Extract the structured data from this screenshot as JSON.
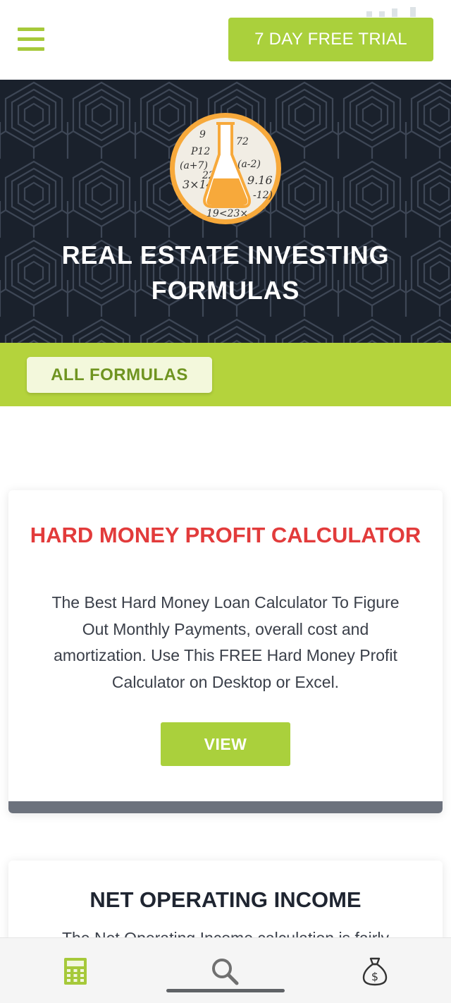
{
  "header": {
    "menu_icon": "hamburger-menu-icon",
    "trial_button_label": "7 DAY FREE TRIAL"
  },
  "hero": {
    "logo_icon": "formula-flask-logo",
    "title": "REAL ESTATE INVESTING FORMULAS"
  },
  "filter": {
    "all_formulas_label": "ALL FORMULAS"
  },
  "cards": [
    {
      "title": "HARD MONEY PROFIT CALCULATOR",
      "description": "The Best Hard Money Loan Calculator To Figure Out Monthly Payments, overall cost and amortization. Use This FREE Hard Money Profit Calculator on Desktop or Excel.",
      "button_label": "VIEW"
    },
    {
      "title": "NET OPERATING INCOME",
      "description": "The Net Operating Income calculation is fairly"
    }
  ],
  "bottom_nav": [
    {
      "icon": "calculator-icon",
      "active": true
    },
    {
      "icon": "search-icon",
      "active": false
    },
    {
      "icon": "money-bag-icon",
      "active": false
    }
  ],
  "colors": {
    "accent_green": "#aad03c",
    "filter_bar_green": "#b4d33c",
    "hero_dark": "#1a212c",
    "card_title_red": "#e23b3b",
    "logo_orange": "#f7a93b"
  }
}
